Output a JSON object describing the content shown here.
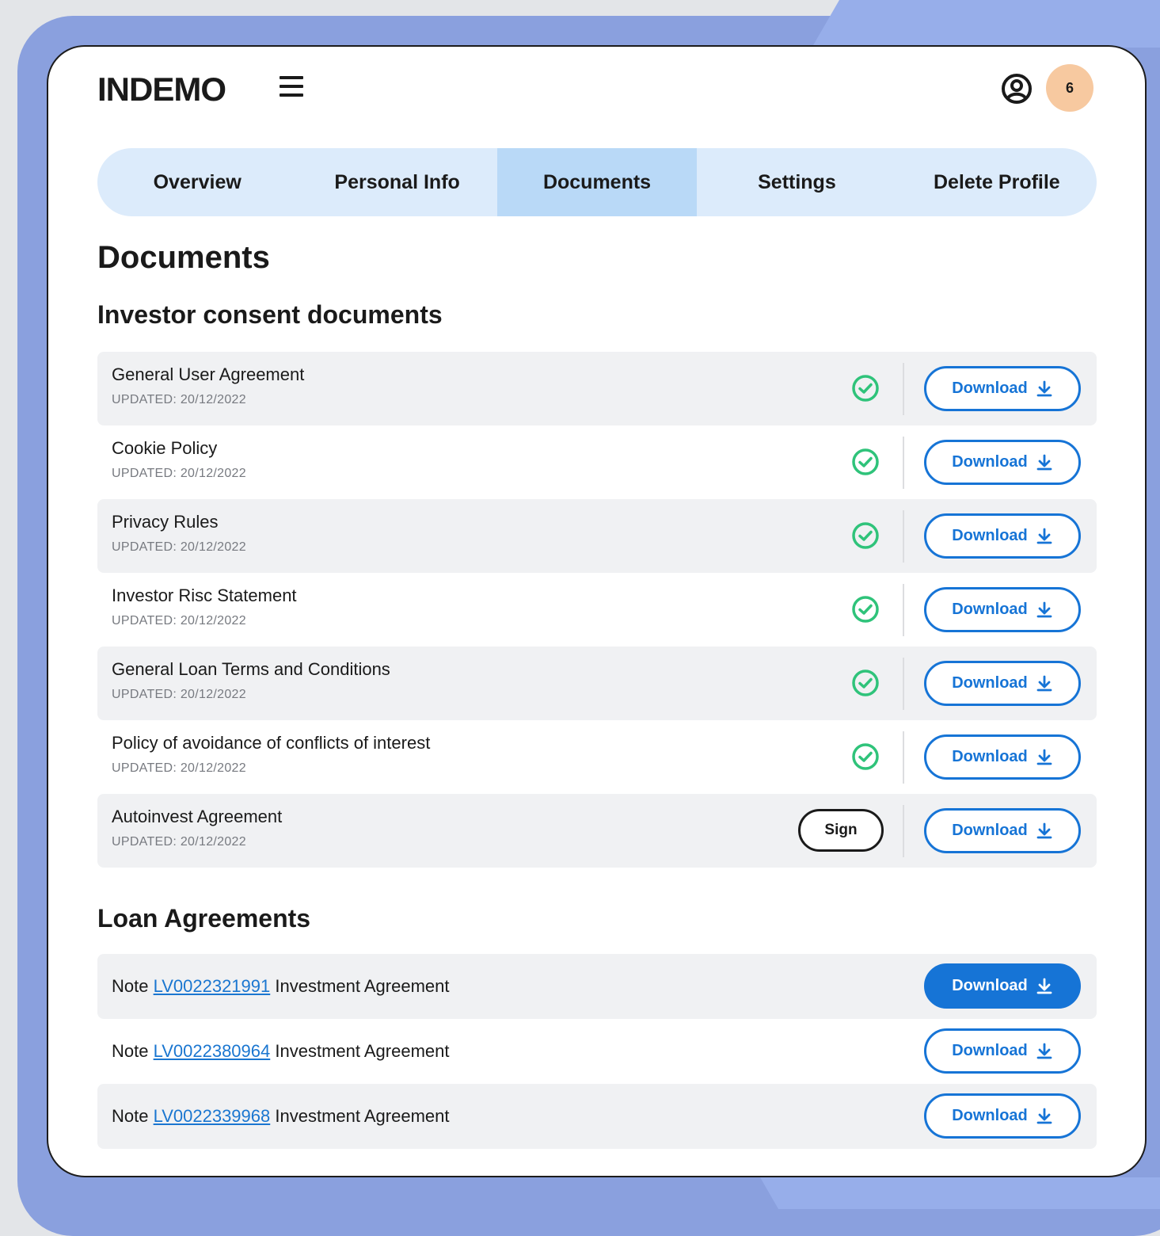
{
  "app": {
    "logo": "INDEMO",
    "notification_count": "6"
  },
  "tabs": [
    "Overview",
    "Personal Info",
    "Documents",
    "Settings",
    "Delete Profile"
  ],
  "page_title": "Documents",
  "consent_section": {
    "title": "Investor consent documents",
    "items": [
      {
        "name": "General User Agreement",
        "date": "UPDATED: 20/12/2022",
        "status": "signed"
      },
      {
        "name": "Cookie Policy",
        "date": "UPDATED: 20/12/2022",
        "status": "signed"
      },
      {
        "name": "Privacy Rules",
        "date": "UPDATED: 20/12/2022",
        "status": "signed"
      },
      {
        "name": "Investor Risc Statement",
        "date": "UPDATED: 20/12/2022",
        "status": "signed"
      },
      {
        "name": "General Loan Terms and Conditions",
        "date": "UPDATED: 20/12/2022",
        "status": "signed"
      },
      {
        "name": "Policy of avoidance of conflicts of interest",
        "date": "UPDATED: 20/12/2022",
        "status": "signed"
      },
      {
        "name": "Autoinvest Agreement",
        "date": "UPDATED: 20/12/2022",
        "status": "unsigned"
      }
    ],
    "sign_label": "Sign",
    "download_label": "Download"
  },
  "loan_section": {
    "title": "Loan Agreements",
    "items": [
      {
        "prefix": "Note",
        "code": "LV0022321991",
        "suffix": "Investment Agreement"
      },
      {
        "prefix": "Note",
        "code": "LV0022380964",
        "suffix": "Investment Agreement"
      },
      {
        "prefix": "Note",
        "code": "LV0022339968",
        "suffix": "Investment Agreement"
      }
    ],
    "download_label": "Download"
  },
  "colors": {
    "accent": "#1674d6",
    "success": "#2fc37a",
    "tab_active": "#b9d9f7",
    "badge": "#f7c9a0"
  }
}
